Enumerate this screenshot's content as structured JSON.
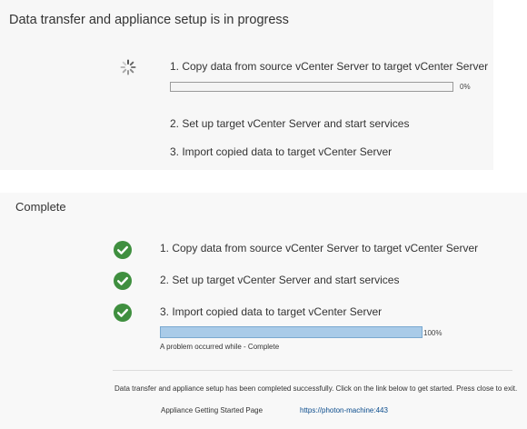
{
  "progress_section": {
    "title": "Data transfer and appliance setup is in progress",
    "steps": [
      {
        "label": "1. Copy data from source vCenter Server to target vCenter Server",
        "progress_percent": 0,
        "progress_label": "0%"
      },
      {
        "label": "2. Set up target vCenter Server and start services"
      },
      {
        "label": "3. Import copied data to target vCenter Server"
      }
    ]
  },
  "complete_section": {
    "title": "Complete",
    "steps": [
      {
        "label": "1. Copy data from source vCenter Server to target vCenter Server"
      },
      {
        "label": "2. Set up target vCenter Server and start services"
      },
      {
        "label": "3. Import copied data to target vCenter Server",
        "progress_percent": 100,
        "progress_label": "100%"
      }
    ],
    "status_note": "A problem occurred while - Complete",
    "message": "Data transfer and appliance setup has been completed successfully. Click on the link below to get started. Press close to exit.",
    "link_label": "Appliance Getting Started Page",
    "link_url": "https://photon-machine:443"
  },
  "colors": {
    "check_green": "#3f8f3f",
    "progress_fill": "#a9cbe8",
    "link": "#0a4b8c"
  }
}
